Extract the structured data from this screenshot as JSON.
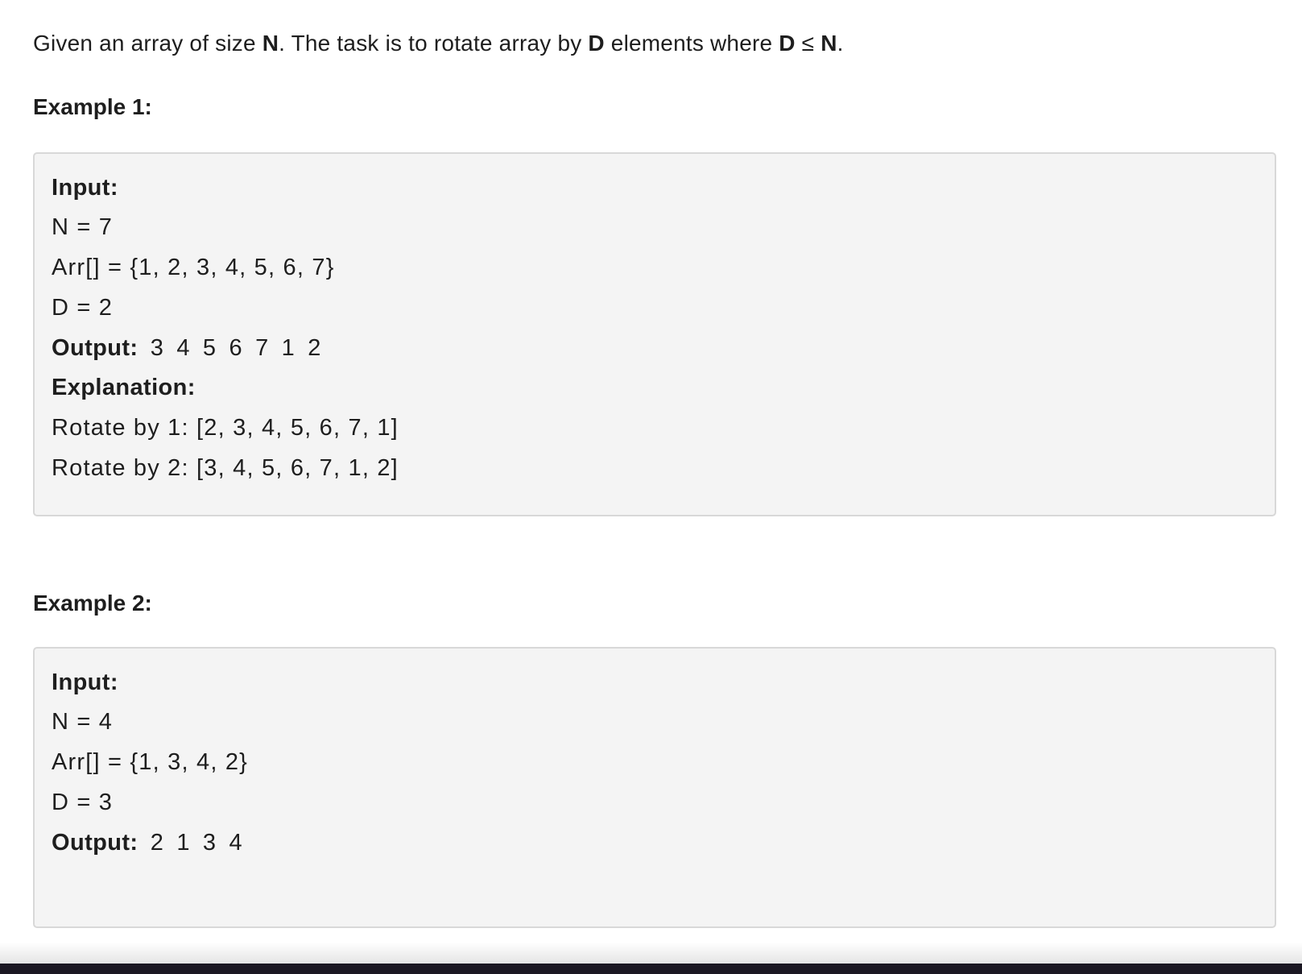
{
  "statement": {
    "p1": "Given an array of size ",
    "b1": "N",
    "p2": ". The task is to rotate array by ",
    "b2": "D",
    "p3": " elements where ",
    "b3": "D",
    "p4": " ≤ ",
    "b4": "N",
    "p5": "."
  },
  "examples": [
    {
      "heading": "Example 1:",
      "input_label": "Input:",
      "n_line": "N = 7",
      "arr_line": "Arr[] = {1, 2, 3, 4, 5, 6, 7}",
      "d_line": "D = 2",
      "output_label": "Output:",
      "output_value": " 3 4 5 6 7 1 2",
      "explanation_label": "Explanation:",
      "explanation_lines": [
        "Rotate by 1: [2, 3, 4, 5, 6, 7, 1]",
        "Rotate by 2: [3, 4, 5, 6, 7, 1, 2]"
      ]
    },
    {
      "heading": "Example 2:",
      "input_label": "Input:",
      "n_line": "N = 4",
      "arr_line": "Arr[] = {1, 3, 4, 2}",
      "d_line": "D = 3",
      "output_label": "Output:",
      "output_value": " 2 1 3 4"
    }
  ]
}
